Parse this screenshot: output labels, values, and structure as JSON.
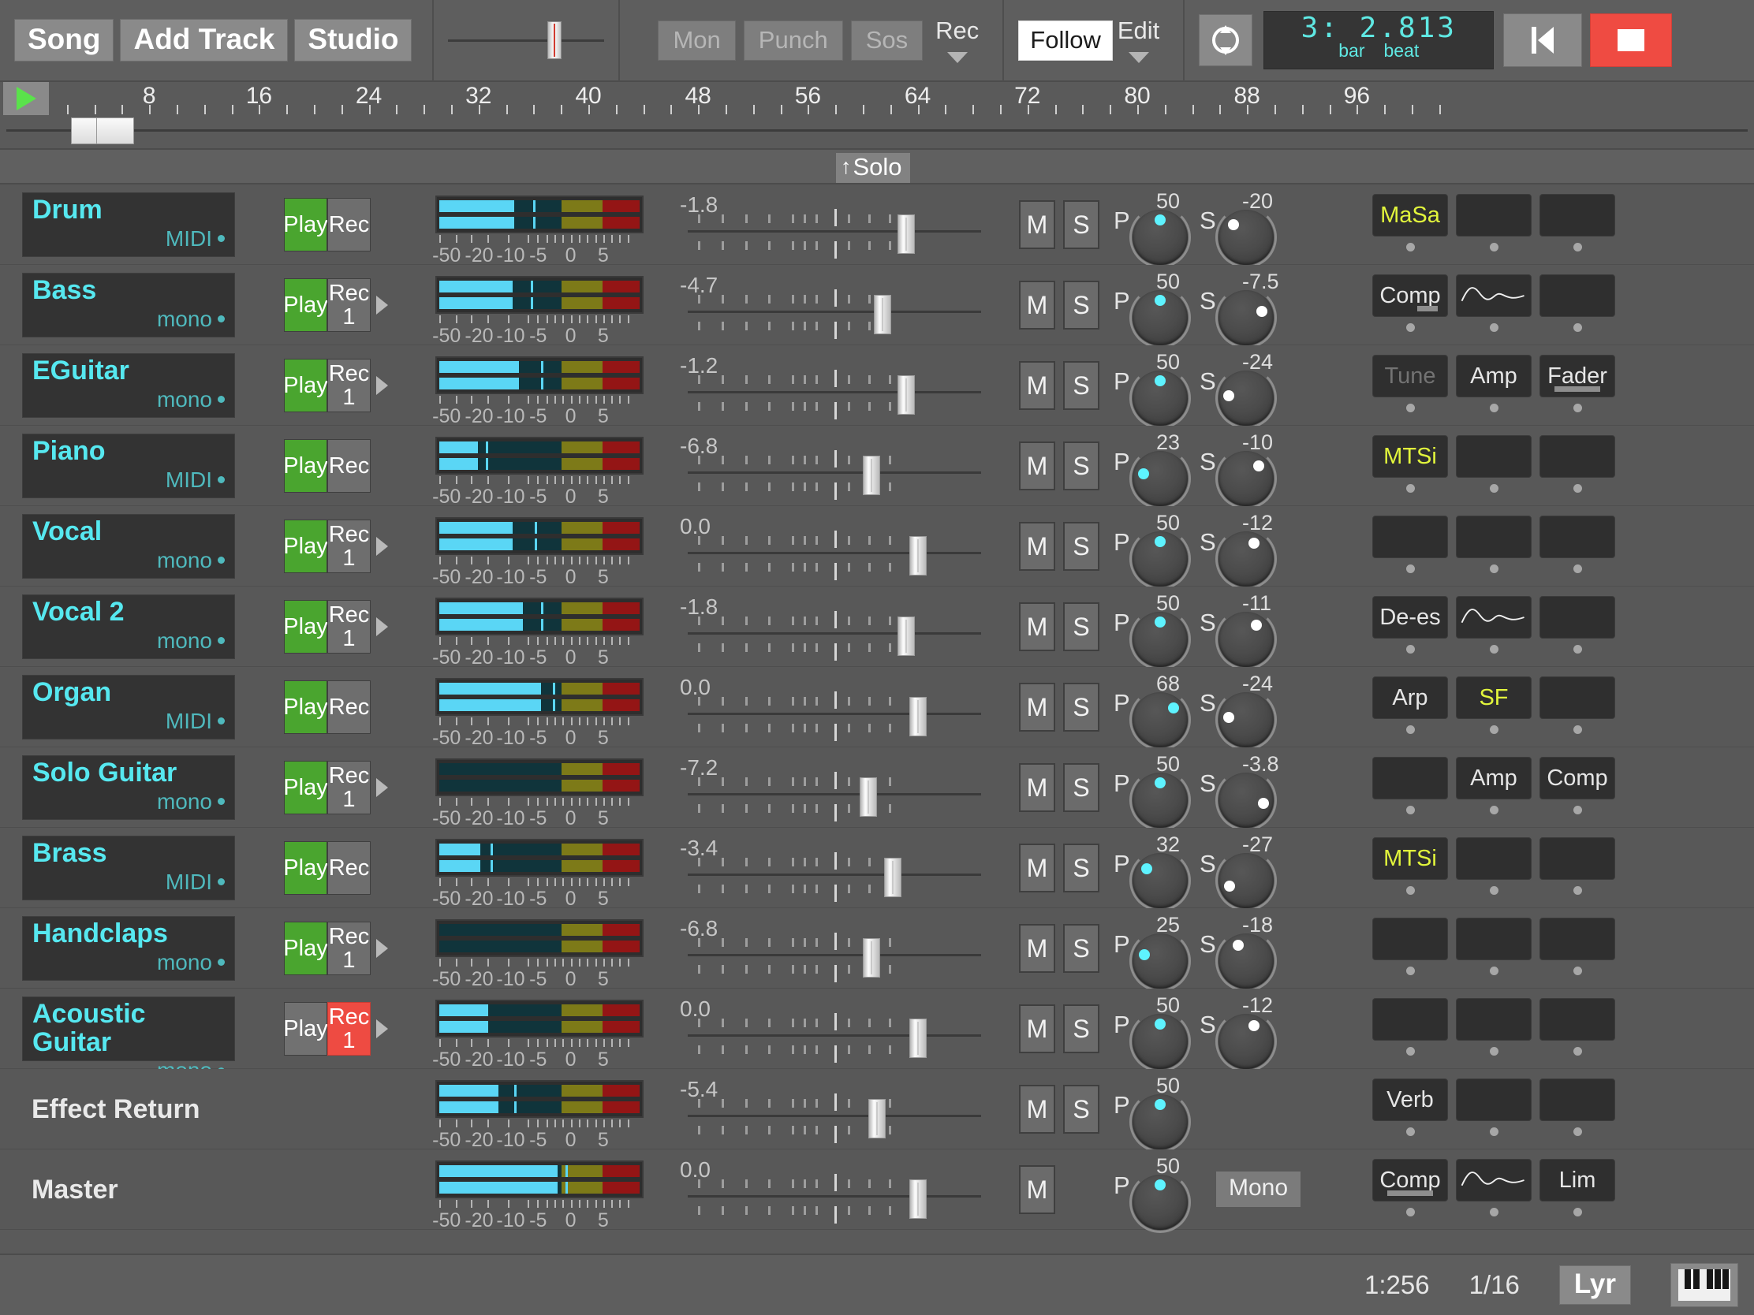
{
  "toolbar": {
    "song_label": "Song",
    "add_track_label": "Add Track",
    "studio_label": "Studio",
    "mon_label": "Mon",
    "punch_label": "Punch",
    "sos_label": "Sos",
    "rec_label": "Rec",
    "follow_label": "Follow",
    "edit_label": "Edit",
    "loop_icon": "loop-icon",
    "rewind_icon": "rewind-to-start-icon",
    "stop_icon": "stop-icon"
  },
  "transport_display": {
    "value": "3: 2.813",
    "bar_label": "bar",
    "beat_label": "beat"
  },
  "ruler": {
    "play_icon": "play-icon",
    "marks": [
      8,
      16,
      24,
      32,
      40,
      48,
      56,
      64,
      72,
      80,
      88,
      96
    ]
  },
  "solo_header": {
    "label": "Solo",
    "arrow": "↑"
  },
  "meter_scale": [
    "-50",
    "-20",
    "-10",
    "-5",
    "0",
    "5"
  ],
  "tracks": [
    {
      "name": "Drum",
      "type": "MIDI",
      "is_bus": false,
      "play": "Play",
      "play_on": true,
      "rec": "Rec",
      "rec_input": "",
      "rec_on": false,
      "has_arrow": false,
      "meter_fill": 0.37,
      "meter_peak": 0.46,
      "fader_value": "-1.8",
      "fader_pos": 0.745,
      "mute": "M",
      "solo": "S",
      "pan_label": "P",
      "pan_value": "50",
      "send_label": "S",
      "send_value": "-20",
      "slots": [
        {
          "text": "MaSa",
          "style": "yellow"
        },
        {
          "text": "",
          "style": "empty"
        },
        {
          "text": "",
          "style": "empty"
        }
      ]
    },
    {
      "name": "Bass",
      "type": "mono",
      "is_bus": false,
      "play": "Play",
      "play_on": true,
      "rec": "Rec",
      "rec_input": "1",
      "rec_on": false,
      "has_arrow": true,
      "meter_fill": 0.36,
      "meter_peak": 0.45,
      "fader_value": "-4.7",
      "fader_pos": 0.665,
      "mute": "M",
      "solo": "S",
      "pan_label": "P",
      "pan_value": "50",
      "send_label": "S",
      "send_value": "-7.5",
      "slots": [
        {
          "text": "Comp",
          "style": "underline-short"
        },
        {
          "text": "",
          "style": "curve"
        },
        {
          "text": "",
          "style": "empty"
        }
      ]
    },
    {
      "name": "EGuitar",
      "type": "mono",
      "is_bus": false,
      "play": "Play",
      "play_on": true,
      "rec": "Rec",
      "rec_input": "1",
      "rec_on": false,
      "has_arrow": true,
      "meter_fill": 0.39,
      "meter_peak": 0.5,
      "fader_value": "-1.2",
      "fader_pos": 0.745,
      "mute": "M",
      "solo": "S",
      "pan_label": "P",
      "pan_value": "50",
      "send_label": "S",
      "send_value": "-24",
      "slots": [
        {
          "text": "Tune",
          "style": "dim"
        },
        {
          "text": "Amp",
          "style": "normal"
        },
        {
          "text": "Fader",
          "style": "underline-long"
        }
      ]
    },
    {
      "name": "Piano",
      "type": "MIDI",
      "is_bus": false,
      "play": "Play",
      "play_on": true,
      "rec": "Rec",
      "rec_input": "",
      "rec_on": false,
      "has_arrow": false,
      "meter_fill": 0.19,
      "meter_peak": 0.23,
      "fader_value": "-6.8",
      "fader_pos": 0.625,
      "mute": "M",
      "solo": "S",
      "pan_label": "P",
      "pan_value": "23",
      "send_label": "S",
      "send_value": "-10",
      "slots": [
        {
          "text": "MTSi",
          "style": "yellow"
        },
        {
          "text": "",
          "style": "empty"
        },
        {
          "text": "",
          "style": "empty"
        }
      ]
    },
    {
      "name": "Vocal",
      "type": "mono",
      "is_bus": false,
      "play": "Play",
      "play_on": true,
      "rec": "Rec",
      "rec_input": "1",
      "rec_on": false,
      "has_arrow": true,
      "meter_fill": 0.36,
      "meter_peak": 0.47,
      "fader_value": "0.0",
      "fader_pos": 0.785,
      "mute": "M",
      "solo": "S",
      "pan_label": "P",
      "pan_value": "50",
      "send_label": "S",
      "send_value": "-12",
      "slots": [
        {
          "text": "",
          "style": "empty"
        },
        {
          "text": "",
          "style": "empty"
        },
        {
          "text": "",
          "style": "empty"
        }
      ]
    },
    {
      "name": "Vocal 2",
      "type": "mono",
      "is_bus": false,
      "play": "Play",
      "play_on": true,
      "rec": "Rec",
      "rec_input": "1",
      "rec_on": false,
      "has_arrow": true,
      "meter_fill": 0.41,
      "meter_peak": 0.5,
      "fader_value": "-1.8",
      "fader_pos": 0.745,
      "mute": "M",
      "solo": "S",
      "pan_label": "P",
      "pan_value": "50",
      "send_label": "S",
      "send_value": "-11",
      "slots": [
        {
          "text": "De-es",
          "style": "normal"
        },
        {
          "text": "",
          "style": "curve"
        },
        {
          "text": "",
          "style": "empty"
        }
      ]
    },
    {
      "name": "Organ",
      "type": "MIDI",
      "is_bus": false,
      "play": "Play",
      "play_on": true,
      "rec": "Rec",
      "rec_input": "",
      "rec_on": false,
      "has_arrow": false,
      "meter_fill": 0.5,
      "meter_peak": 0.56,
      "fader_value": "0.0",
      "fader_pos": 0.785,
      "mute": "M",
      "solo": "S",
      "pan_label": "P",
      "pan_value": "68",
      "send_label": "S",
      "send_value": "-24",
      "slots": [
        {
          "text": "Arp",
          "style": "normal"
        },
        {
          "text": "SF",
          "style": "yellow"
        },
        {
          "text": "",
          "style": "empty"
        }
      ]
    },
    {
      "name": "Solo Guitar",
      "type": "mono",
      "is_bus": false,
      "play": "Play",
      "play_on": true,
      "rec": "Rec",
      "rec_input": "1",
      "rec_on": false,
      "has_arrow": true,
      "meter_fill": 0.0,
      "meter_peak": 0.0,
      "fader_value": "-7.2",
      "fader_pos": 0.615,
      "mute": "M",
      "solo": "S",
      "pan_label": "P",
      "pan_value": "50",
      "send_label": "S",
      "send_value": "-3.8",
      "slots": [
        {
          "text": "",
          "style": "empty"
        },
        {
          "text": "Amp",
          "style": "normal"
        },
        {
          "text": "Comp",
          "style": "normal"
        }
      ]
    },
    {
      "name": "Brass",
      "type": "MIDI",
      "is_bus": false,
      "play": "Play",
      "play_on": true,
      "rec": "Rec",
      "rec_input": "",
      "rec_on": false,
      "has_arrow": false,
      "meter_fill": 0.2,
      "meter_peak": 0.25,
      "fader_value": "-3.4",
      "fader_pos": 0.7,
      "mute": "M",
      "solo": "S",
      "pan_label": "P",
      "pan_value": "32",
      "send_label": "S",
      "send_value": "-27",
      "slots": [
        {
          "text": "MTSi",
          "style": "yellow"
        },
        {
          "text": "",
          "style": "empty"
        },
        {
          "text": "",
          "style": "empty"
        }
      ]
    },
    {
      "name": "Handclaps",
      "type": "mono",
      "is_bus": false,
      "play": "Play",
      "play_on": true,
      "rec": "Rec",
      "rec_input": "1",
      "rec_on": false,
      "has_arrow": true,
      "meter_fill": 0.0,
      "meter_peak": 0.0,
      "fader_value": "-6.8",
      "fader_pos": 0.625,
      "mute": "M",
      "solo": "S",
      "pan_label": "P",
      "pan_value": "25",
      "send_label": "S",
      "send_value": "-18",
      "slots": [
        {
          "text": "",
          "style": "empty"
        },
        {
          "text": "",
          "style": "empty"
        },
        {
          "text": "",
          "style": "empty"
        }
      ]
    },
    {
      "name": "Acoustic Guitar",
      "type": "mono",
      "is_bus": false,
      "play": "Play",
      "play_on": false,
      "rec": "Rec",
      "rec_input": "1",
      "rec_on": true,
      "has_arrow": true,
      "meter_fill": 0.24,
      "meter_peak": 0.0,
      "fader_value": "0.0",
      "fader_pos": 0.785,
      "mute": "M",
      "solo": "S",
      "pan_label": "P",
      "pan_value": "50",
      "send_label": "S",
      "send_value": "-12",
      "slots": [
        {
          "text": "",
          "style": "empty"
        },
        {
          "text": "",
          "style": "empty"
        },
        {
          "text": "",
          "style": "empty"
        }
      ]
    },
    {
      "name": "Effect Return",
      "type": "",
      "is_bus": true,
      "play": "",
      "play_on": false,
      "rec": "",
      "rec_input": "",
      "rec_on": false,
      "has_arrow": false,
      "meter_fill": 0.29,
      "meter_peak": 0.37,
      "fader_value": "-5.4",
      "fader_pos": 0.645,
      "mute": "M",
      "solo": "S",
      "pan_label": "P",
      "pan_value": "50",
      "send_label": "",
      "send_value": "",
      "slots": [
        {
          "text": "Verb",
          "style": "normal"
        },
        {
          "text": "",
          "style": "empty"
        },
        {
          "text": "",
          "style": "empty"
        }
      ]
    },
    {
      "name": "Master",
      "type": "",
      "is_bus": true,
      "is_master": true,
      "play": "",
      "play_on": false,
      "rec": "",
      "rec_input": "",
      "rec_on": false,
      "has_arrow": false,
      "meter_fill": 0.58,
      "meter_peak": 0.62,
      "fader_value": "0.0",
      "fader_pos": 0.785,
      "mute": "M",
      "solo": "",
      "pan_label": "P",
      "pan_value": "50",
      "send_label": "",
      "send_value": "",
      "mono_label": "Mono",
      "slots": [
        {
          "text": "Comp",
          "style": "underline-long"
        },
        {
          "text": "",
          "style": "curve"
        },
        {
          "text": "Lim",
          "style": "normal"
        }
      ]
    }
  ],
  "status_bar": {
    "resolution": "1:256",
    "quantize": "1/16",
    "lyr_label": "Lyr",
    "keyboard_icon": "piano-keyboard-icon"
  }
}
